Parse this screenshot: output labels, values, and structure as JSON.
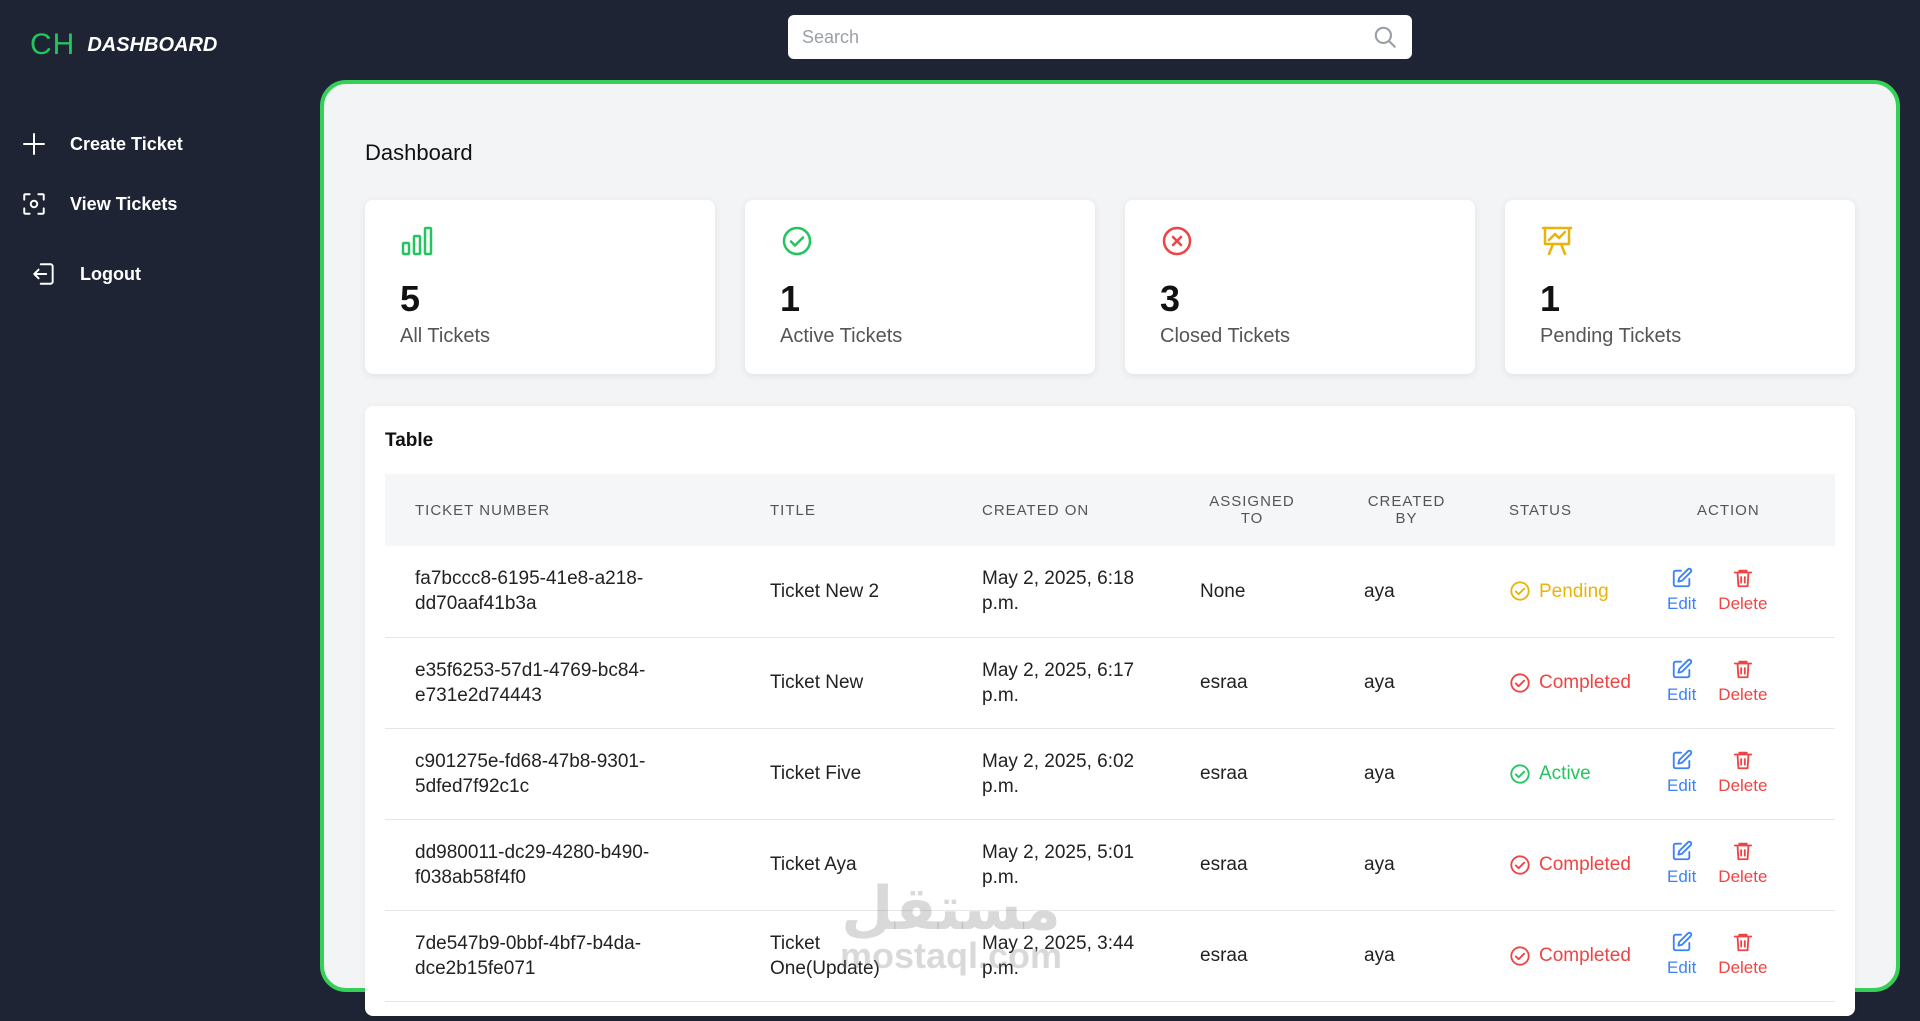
{
  "brand": {
    "short": "CH",
    "title": "DASHBOARD"
  },
  "nav": {
    "create": "Create Ticket",
    "view": "View Tickets",
    "logout": "Logout"
  },
  "search": {
    "placeholder": "Search",
    "value": ""
  },
  "page_title": "Dashboard",
  "cards": [
    {
      "value": "5",
      "label": "All Tickets",
      "icon": "bar-chart-icon",
      "color": "#22c55e"
    },
    {
      "value": "1",
      "label": "Active Tickets",
      "icon": "check-circle-icon",
      "color": "#22c55e"
    },
    {
      "value": "3",
      "label": "Closed Tickets",
      "icon": "x-circle-icon",
      "color": "#ef4444"
    },
    {
      "value": "1",
      "label": "Pending Tickets",
      "icon": "presentation-chart-icon",
      "color": "#eab308"
    }
  ],
  "table": {
    "title": "Table",
    "headers": [
      "Ticket Number",
      "Title",
      "Created On",
      "Assigned to",
      "Created by",
      "Status",
      "Action"
    ],
    "header_lines": {
      "assigned_1": "ASSIGNED",
      "assigned_2": "TO",
      "created_1": "CREATED",
      "created_2": "BY"
    },
    "edit_label": "Edit",
    "delete_label": "Delete",
    "rows": [
      {
        "ticket_1": "fa7bccc8-6195-41e8-a218-",
        "ticket_2": "dd70aaf41b3a",
        "title_1": "Ticket New 2",
        "title_2": "",
        "date_1": "May 2, 2025, 6:18",
        "date_2": "p.m.",
        "assigned": "None",
        "created_by": "aya",
        "status": "Pending"
      },
      {
        "ticket_1": "e35f6253-57d1-4769-bc84-",
        "ticket_2": "e731e2d74443",
        "title_1": "Ticket New",
        "title_2": "",
        "date_1": "May 2, 2025, 6:17",
        "date_2": "p.m.",
        "assigned": "esraa",
        "created_by": "aya",
        "status": "Completed"
      },
      {
        "ticket_1": "c901275e-fd68-47b8-9301-",
        "ticket_2": "5dfed7f92c1c",
        "title_1": "Ticket Five",
        "title_2": "",
        "date_1": "May 2, 2025, 6:02",
        "date_2": "p.m.",
        "assigned": "esraa",
        "created_by": "aya",
        "status": "Active"
      },
      {
        "ticket_1": "dd980011-dc29-4280-b490-",
        "ticket_2": "f038ab58f4f0",
        "title_1": "Ticket Aya",
        "title_2": "",
        "date_1": "May 2, 2025, 5:01",
        "date_2": "p.m.",
        "assigned": "esraa",
        "created_by": "aya",
        "status": "Completed"
      },
      {
        "ticket_1": "7de547b9-0bbf-4bf7-b4da-",
        "ticket_2": "dce2b15fe071",
        "title_1": "Ticket",
        "title_2": "One(Update)",
        "date_1": "May 2, 2025, 3:44",
        "date_2": "p.m.",
        "assigned": "esraa",
        "created_by": "aya",
        "status": "Completed"
      }
    ]
  },
  "status_colors": {
    "Pending": "#eab308",
    "Completed": "#ef4444",
    "Active": "#22c55e"
  },
  "watermark": {
    "arabic": "مستقل",
    "latin": "mostaql.com"
  }
}
